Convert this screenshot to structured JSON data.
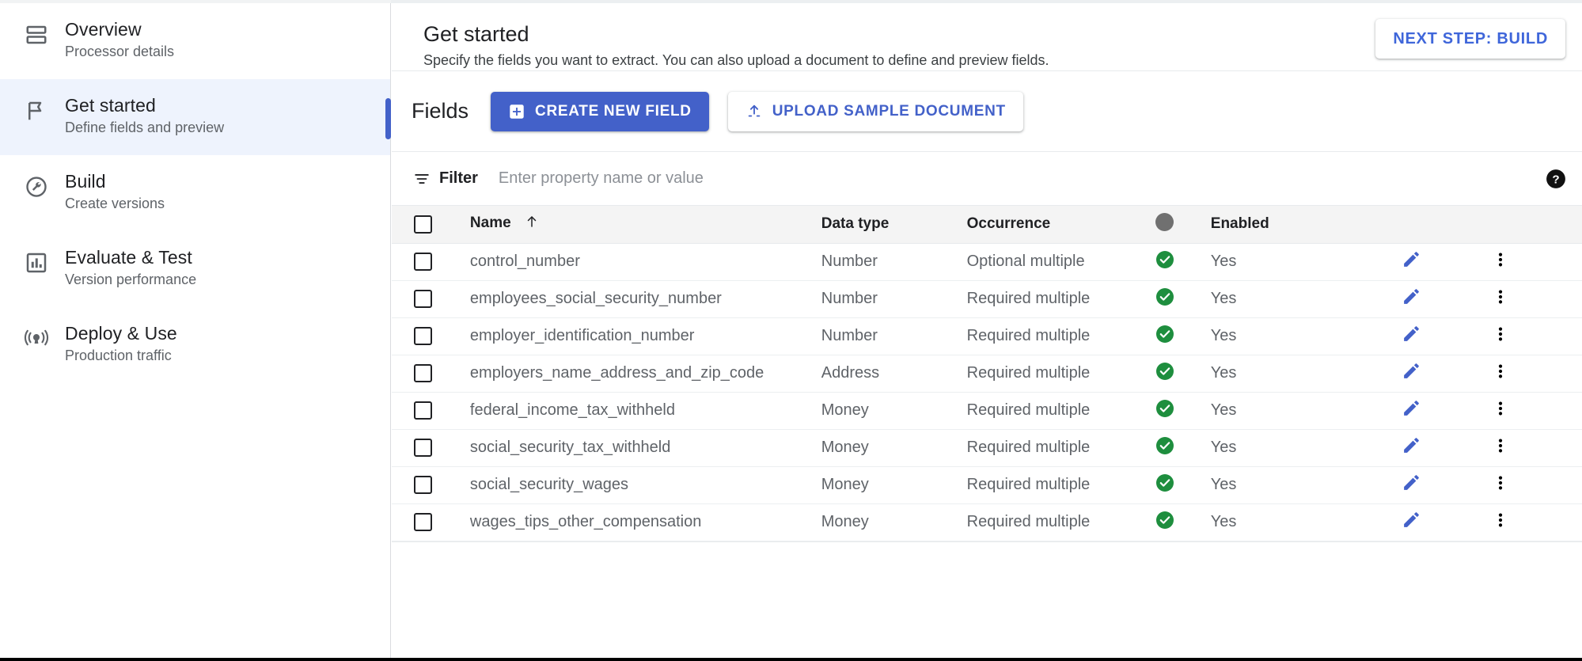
{
  "sidebar": {
    "items": [
      {
        "icon": "overview-icon",
        "title": "Overview",
        "subtitle": "Processor details",
        "selected": false
      },
      {
        "icon": "flag-icon",
        "title": "Get started",
        "subtitle": "Define fields and preview",
        "selected": true
      },
      {
        "icon": "wrench-icon",
        "title": "Build",
        "subtitle": "Create versions",
        "selected": false
      },
      {
        "icon": "bar-chart-icon",
        "title": "Evaluate & Test",
        "subtitle": "Version performance",
        "selected": false
      },
      {
        "icon": "broadcast-icon",
        "title": "Deploy & Use",
        "subtitle": "Production traffic",
        "selected": false
      }
    ]
  },
  "header": {
    "title": "Get started",
    "subtitle": "Specify the fields you want to extract. You can also upload a document to define and preview fields.",
    "next_step_label": "NEXT STEP: BUILD"
  },
  "toolbar": {
    "fields_label": "Fields",
    "create_field_label": "CREATE NEW FIELD",
    "upload_label": "UPLOAD SAMPLE DOCUMENT"
  },
  "filter": {
    "label": "Filter",
    "placeholder": "Enter property name or value",
    "value": ""
  },
  "table": {
    "columns": [
      "Name",
      "Data type",
      "Occurrence",
      "",
      "Enabled"
    ],
    "sort_column": "Name",
    "sort_direction": "ascending",
    "rows": [
      {
        "name": "control_number",
        "data_type": "Number",
        "occurrence": "Optional multiple",
        "status": "ok",
        "enabled": "Yes"
      },
      {
        "name": "employees_social_security_number",
        "data_type": "Number",
        "occurrence": "Required multiple",
        "status": "ok",
        "enabled": "Yes"
      },
      {
        "name": "employer_identification_number",
        "data_type": "Number",
        "occurrence": "Required multiple",
        "status": "ok",
        "enabled": "Yes"
      },
      {
        "name": "employers_name_address_and_zip_code",
        "data_type": "Address",
        "occurrence": "Required multiple",
        "status": "ok",
        "enabled": "Yes"
      },
      {
        "name": "federal_income_tax_withheld",
        "data_type": "Money",
        "occurrence": "Required multiple",
        "status": "ok",
        "enabled": "Yes"
      },
      {
        "name": "social_security_tax_withheld",
        "data_type": "Money",
        "occurrence": "Required multiple",
        "status": "ok",
        "enabled": "Yes"
      },
      {
        "name": "social_security_wages",
        "data_type": "Money",
        "occurrence": "Required multiple",
        "status": "ok",
        "enabled": "Yes"
      },
      {
        "name": "wages_tips_other_compensation",
        "data_type": "Money",
        "occurrence": "Required multiple",
        "status": "ok",
        "enabled": "Yes"
      }
    ]
  },
  "colors": {
    "accent_blue": "#4361c9",
    "status_green": "#1e8e3e",
    "selected_row": "#eef3fd",
    "header_gray": "#f4f4f4"
  }
}
